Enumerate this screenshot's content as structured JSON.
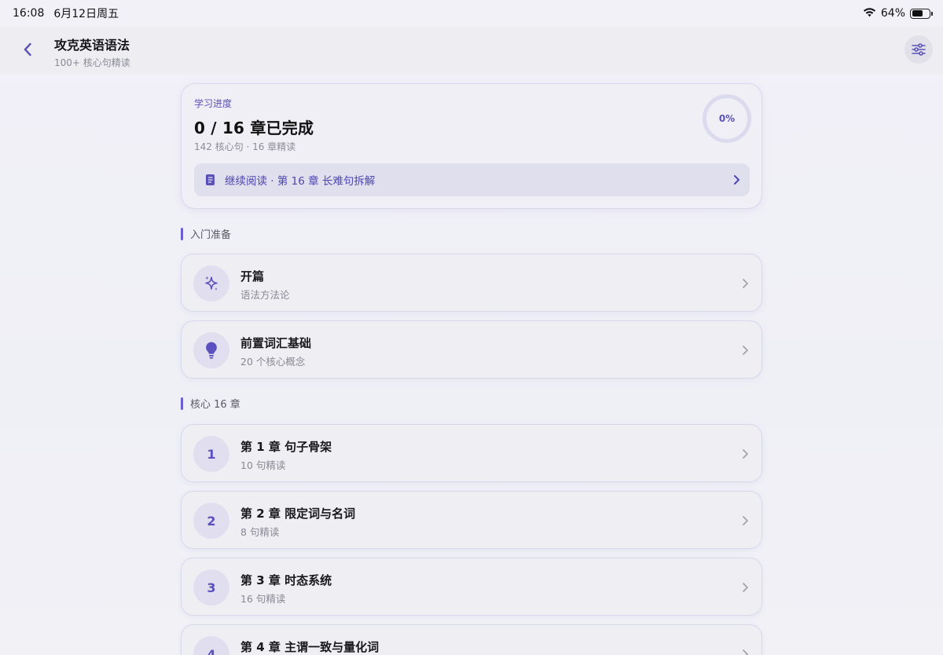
{
  "status_bar": {
    "time": "16:08",
    "date": "6月12日周五",
    "battery": "64%",
    "battery_level": 0.64,
    "wifi_icon": "wifi-icon"
  },
  "nav": {
    "title": "攻克英语语法",
    "subtitle": "100+ 核心句精读",
    "back_icon": "chevron-left-icon",
    "settings_icon": "sliders-icon",
    "accent": "#5b52b8"
  },
  "progress": {
    "label": "学习进度",
    "title": "0 / 16 章已完成",
    "meta": "142 核心句 · 16 章精读",
    "percent": "0%",
    "continue_text": "继续阅读 · 第 16 章 长难句拆解"
  },
  "sections": [
    {
      "title": "入门准备"
    },
    {
      "title": "核心 16 章"
    }
  ],
  "prep_items": [
    {
      "title": "开篇",
      "subtitle": "语法方法论",
      "icon": "sparkles-icon"
    },
    {
      "title": "前置词汇基础",
      "subtitle": "20 个核心概念",
      "icon": "lightbulb-icon"
    }
  ],
  "chapters": [
    {
      "number": "1",
      "title": "第 1 章 句子骨架",
      "subtitle": "10 句精读"
    },
    {
      "number": "2",
      "title": "第 2 章 限定词与名词",
      "subtitle": "8 句精读"
    },
    {
      "number": "3",
      "title": "第 3 章 时态系统",
      "subtitle": "16 句精读"
    },
    {
      "number": "4",
      "title": "第 4 章 主谓一致与量化词",
      "subtitle": ""
    }
  ]
}
